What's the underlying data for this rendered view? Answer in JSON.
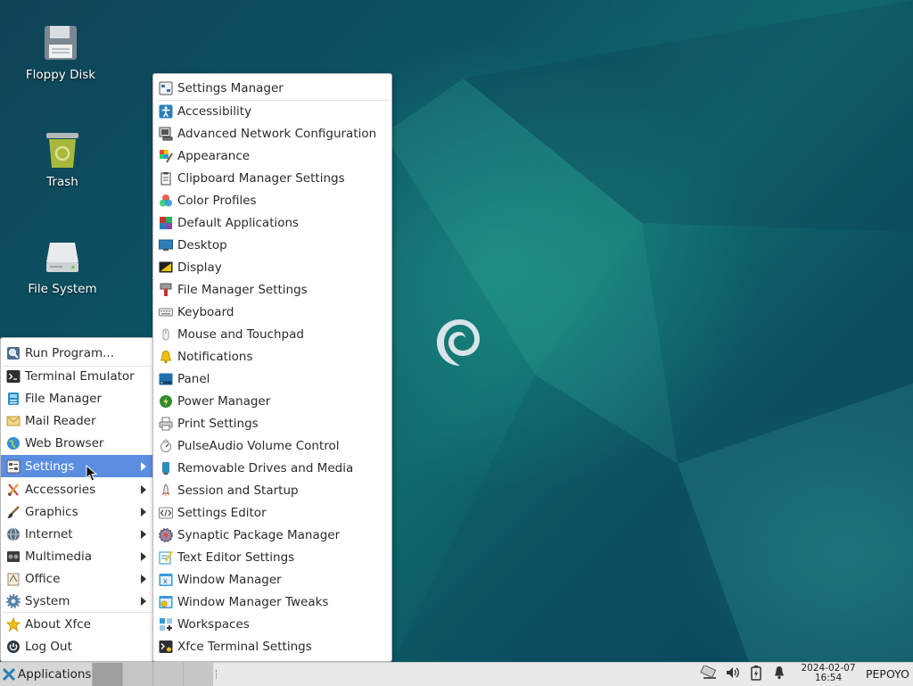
{
  "desktop": {
    "icons": [
      {
        "label": "Floppy Disk",
        "icon": "floppy-disk-icon"
      },
      {
        "label": "Trash",
        "icon": "trash-icon"
      },
      {
        "label": "File System",
        "icon": "hard-drive-icon"
      }
    ]
  },
  "applications_menu": {
    "items": [
      {
        "label": "Run Program...",
        "icon": "search-icon"
      },
      {
        "label": "Terminal Emulator",
        "icon": "terminal-icon"
      },
      {
        "label": "File Manager",
        "icon": "file-manager-icon"
      },
      {
        "label": "Mail Reader",
        "icon": "mail-icon"
      },
      {
        "label": "Web Browser",
        "icon": "globe-icon"
      },
      {
        "label": "Settings",
        "icon": "settings-icon",
        "submenu": true,
        "active": true
      },
      {
        "label": "Accessories",
        "icon": "accessories-icon",
        "submenu": true
      },
      {
        "label": "Graphics",
        "icon": "brush-icon",
        "submenu": true
      },
      {
        "label": "Internet",
        "icon": "internet-icon",
        "submenu": true
      },
      {
        "label": "Multimedia",
        "icon": "multimedia-icon",
        "submenu": true
      },
      {
        "label": "Office",
        "icon": "office-icon",
        "submenu": true
      },
      {
        "label": "System",
        "icon": "gear-icon",
        "submenu": true
      },
      {
        "label": "About Xfce",
        "icon": "star-icon"
      },
      {
        "label": "Log Out",
        "icon": "logout-icon"
      }
    ]
  },
  "settings_menu": {
    "items": [
      {
        "label": "Settings Manager",
        "icon": "settings-manager-icon"
      },
      {
        "label": "Accessibility",
        "icon": "accessibility-icon"
      },
      {
        "label": "Advanced Network Configuration",
        "icon": "network-icon"
      },
      {
        "label": "Appearance",
        "icon": "appearance-icon"
      },
      {
        "label": "Clipboard Manager Settings",
        "icon": "clipboard-icon"
      },
      {
        "label": "Color Profiles",
        "icon": "color-profiles-icon"
      },
      {
        "label": "Default Applications",
        "icon": "default-apps-icon"
      },
      {
        "label": "Desktop",
        "icon": "desktop-icon"
      },
      {
        "label": "Display",
        "icon": "display-icon"
      },
      {
        "label": "File Manager Settings",
        "icon": "file-manager-settings-icon"
      },
      {
        "label": "Keyboard",
        "icon": "keyboard-icon"
      },
      {
        "label": "Mouse and Touchpad",
        "icon": "mouse-icon"
      },
      {
        "label": "Notifications",
        "icon": "bell-icon"
      },
      {
        "label": "Panel",
        "icon": "panel-icon"
      },
      {
        "label": "Power Manager",
        "icon": "power-icon"
      },
      {
        "label": "Print Settings",
        "icon": "printer-icon"
      },
      {
        "label": "PulseAudio Volume Control",
        "icon": "volume-control-icon"
      },
      {
        "label": "Removable Drives and Media",
        "icon": "removable-drive-icon"
      },
      {
        "label": "Session and Startup",
        "icon": "rocket-icon"
      },
      {
        "label": "Settings Editor",
        "icon": "code-icon"
      },
      {
        "label": "Synaptic Package Manager",
        "icon": "package-manager-icon"
      },
      {
        "label": "Text Editor Settings",
        "icon": "text-editor-icon"
      },
      {
        "label": "Window Manager",
        "icon": "window-manager-icon"
      },
      {
        "label": "Window Manager Tweaks",
        "icon": "window-tweaks-icon"
      },
      {
        "label": "Workspaces",
        "icon": "workspaces-icon"
      },
      {
        "label": "Xfce Terminal Settings",
        "icon": "terminal-settings-icon"
      }
    ]
  },
  "taskbar": {
    "app_button_label": "Applications",
    "clock_date": "2024-02-07",
    "clock_time": "16:54",
    "username": "PEPOYO",
    "tray_icons": [
      "network-icon",
      "volume-icon",
      "battery-icon",
      "bell-icon"
    ]
  },
  "colors": {
    "menu_highlight": "#5b8ee0",
    "desktop_base": "#0c5565"
  }
}
